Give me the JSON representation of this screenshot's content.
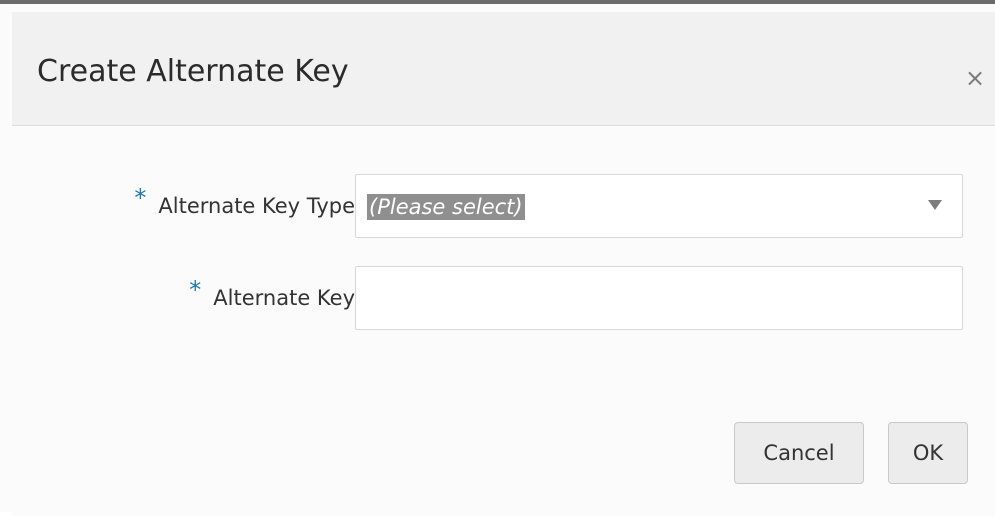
{
  "dialog": {
    "title": "Create Alternate Key",
    "close_icon": "×"
  },
  "form": {
    "required_marker": "*",
    "alternate_key_type": {
      "label": "Alternate Key Type",
      "value": "(Please select)"
    },
    "alternate_key": {
      "label": "Alternate Key",
      "value": ""
    }
  },
  "buttons": {
    "cancel": "Cancel",
    "ok": "OK"
  }
}
